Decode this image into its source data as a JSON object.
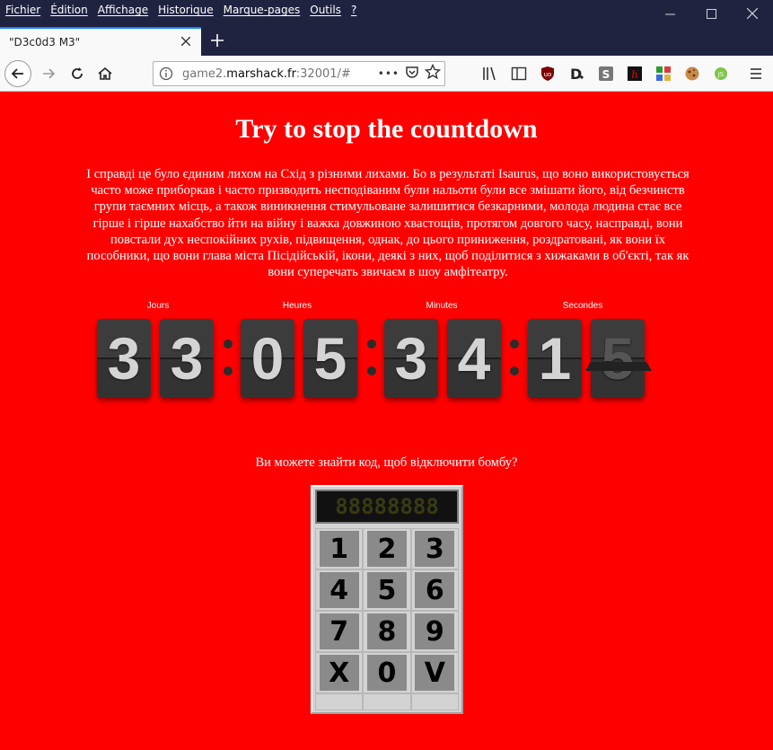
{
  "browser": {
    "menu": [
      "Fichier",
      "Édition",
      "Affichage",
      "Historique",
      "Marque-pages",
      "Outils",
      "?"
    ],
    "tab_title": "\"D3c0d3 M3\"",
    "url_prefix": "game2.",
    "url_domain": "marshack.fr",
    "url_suffix": ":32001/#",
    "url_more": "•••"
  },
  "page": {
    "title": "Try to stop the countdown",
    "paragraph": "І справді це було єдиним лихом на Схід з різними лихами. Бо в результаті Isaurus, що воно використовується часто може приборкав і часто призводить несподіваним були нальоти були все змішати його, від безчинств групи таємних місць, а також виникнення стимульоване залишитися безкарними, молода людина стає все гірше і гірше нахабство йти на війну і важка довжиною хвастощів, протягом довгого часу, насправді, вони повстали дух неспокійних рухів, підвищення, однак, до цього приниження, роздратовані, як вони їх пособники, що вони глава міста Пісідійській, ікони, деякі з них, щоб поділитися з хижаками в об'єкті, так як вони суперечать звичаєм в шоу амфітеатру.",
    "countdown": {
      "labels": {
        "days": "Jours",
        "hours": "Heures",
        "minutes": "Minutes",
        "seconds": "Secondes"
      },
      "digits": [
        "3",
        "3",
        "0",
        "5",
        "3",
        "4",
        "1",
        "5"
      ]
    },
    "question": "Ви можете знайти код, щоб відключити бомбу?",
    "keypad": {
      "display": "88888888",
      "keys": [
        "1",
        "2",
        "3",
        "4",
        "5",
        "6",
        "7",
        "8",
        "9",
        "X",
        "0",
        "V",
        "",
        "",
        ""
      ]
    }
  },
  "colors": {
    "page_bg": "#ff0000",
    "chrome_dark": "#202340",
    "digit_bg": "#333333",
    "keypad_bg": "#d3d3d3"
  }
}
